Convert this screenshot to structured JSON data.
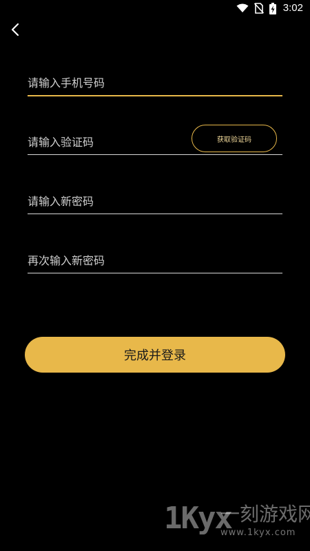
{
  "status_bar": {
    "time": "3:02",
    "icons": [
      "wifi-icon",
      "no-sim-icon",
      "battery-charging-icon"
    ]
  },
  "header": {
    "back_icon": "chevron-left-icon"
  },
  "form": {
    "phone": {
      "placeholder": "请输入手机号码",
      "value": ""
    },
    "code": {
      "placeholder": "请输入验证码",
      "value": "",
      "button_label": "获取验证码"
    },
    "new_password": {
      "placeholder": "请输入新密码",
      "value": ""
    },
    "confirm_password": {
      "placeholder": "再次输入新密码",
      "value": ""
    },
    "submit_label": "完成并登录"
  },
  "watermark": {
    "logo": "1Kyx",
    "name": "一刻游戏网",
    "url": "www.1kyx.com"
  },
  "colors": {
    "accent": "#e8b84a",
    "background": "#000000",
    "underline": "#d9d9d9"
  }
}
